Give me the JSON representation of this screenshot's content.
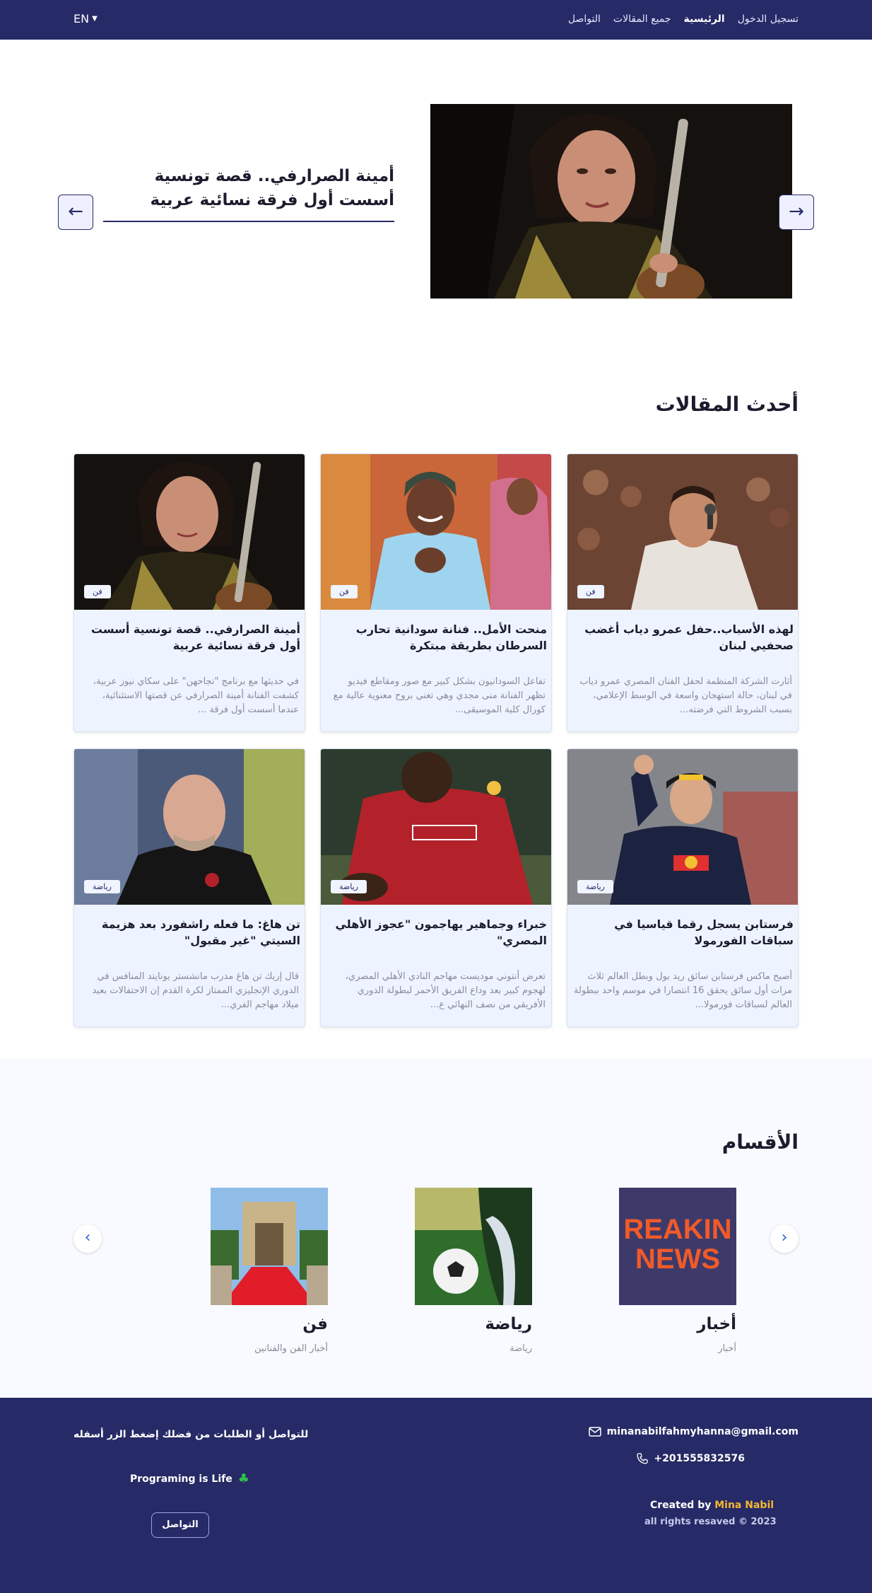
{
  "nav": {
    "lang": "EN",
    "links": [
      "تسجيل الدخول",
      "الرئيسية",
      "جميع المقالات",
      "التواصل"
    ]
  },
  "hero": {
    "title": "أمينة الصرارفي.. قصة تونسية أسست أول فرقة نسائية عربية",
    "prev_icon": "arrow-left-icon",
    "next_icon": "arrow-right-icon"
  },
  "latest": {
    "title": "أحدث المقالات",
    "cards": [
      {
        "badge": "فن",
        "title": "لهذه الأسباب..حفل عمرو دياب أغضب صحفيي لبنان",
        "excerpt": "أثارت الشركة المنظمة لحفل الفنان المصري عمرو دياب في لبنان، حالة استهجان واسعة في الوسط الإعلامي، بسبب الشروط التي فرضته..."
      },
      {
        "badge": "فن",
        "title": "منحت الأمل.. فنانة سودانية تحارب السرطان بطريقة مبتكرة",
        "excerpt": "تفاعل السودانيون بشكل كبير مع صور ومقاطع فيديو تظهر الفنانة منى مجدي وهي تغني بروح معنوية عالية مع كورال كلية الموسيقى..."
      },
      {
        "badge": "فن",
        "title": "أمينة الصرارفي.. قصة تونسية أسست أول فرقة نسائية عربية",
        "excerpt": "في حديثها مع برنامج \"نجاحهن\" على سكاي نيوز عربية، كشفت الفنانة أمينة الصرارفي عن قصتها الاستثنائية، عندما أسست أول فرقة ..."
      },
      {
        "badge": "رياضة",
        "title": "فرستابن يسجل رقما قياسيا في سباقات الفورمولا",
        "excerpt": "أصبح ماكس فرستابن سائق ريد بول وبطل العالم ثلاث مرات أول سائق يحقق 16 انتصارا في موسم واحد ببطولة العالم لسباقات فورمولا..."
      },
      {
        "badge": "رياضة",
        "title": "خبراء وجماهير يهاجمون \"عجوز الأهلي المصري\"",
        "excerpt": "تعرض أنتوني موديست مهاجم النادي الأهلي المصري، لهجوم كبير بعد وداع الفريق الأحمر لبطولة الدوري الأفريقي من نصف النهائي ع..."
      },
      {
        "badge": "رياضة",
        "title": "تن هاغ: ما فعله راشفورد بعد هزيمة السيتي \"غير مقبول\"",
        "excerpt": "قال إريك تن هاغ مدرب مانشستر يونايتد المنافس في الدوري الإنجليزي الممتاز لكرة القدم إن الاحتفالات بعيد ميلاد مهاجم الفري..."
      }
    ]
  },
  "categories": {
    "title": "الأقسام",
    "items": [
      {
        "name": "أخبار",
        "desc": "أخبار",
        "thumb_text": "REAKIN NEWS"
      },
      {
        "name": "رياضة",
        "desc": "رياضة"
      },
      {
        "name": "فن",
        "desc": "أخبار الفن والفنانين"
      }
    ]
  },
  "footer": {
    "email": "minanabilfahmyhanna@gmail.com",
    "phone": "+201555832576",
    "created_by": "Created by",
    "author": "Mina Nabil",
    "rights": "all rights resaved © 2023",
    "contact_text": "للتواصل أو الطلبات من فضلك إضغط الزر أسفله",
    "motto": "Programing is Life",
    "contact_button": "التواصل"
  },
  "colors": {
    "primary": "#262a66",
    "accent": "#f5b731",
    "card_bg": "#eef4ff"
  }
}
